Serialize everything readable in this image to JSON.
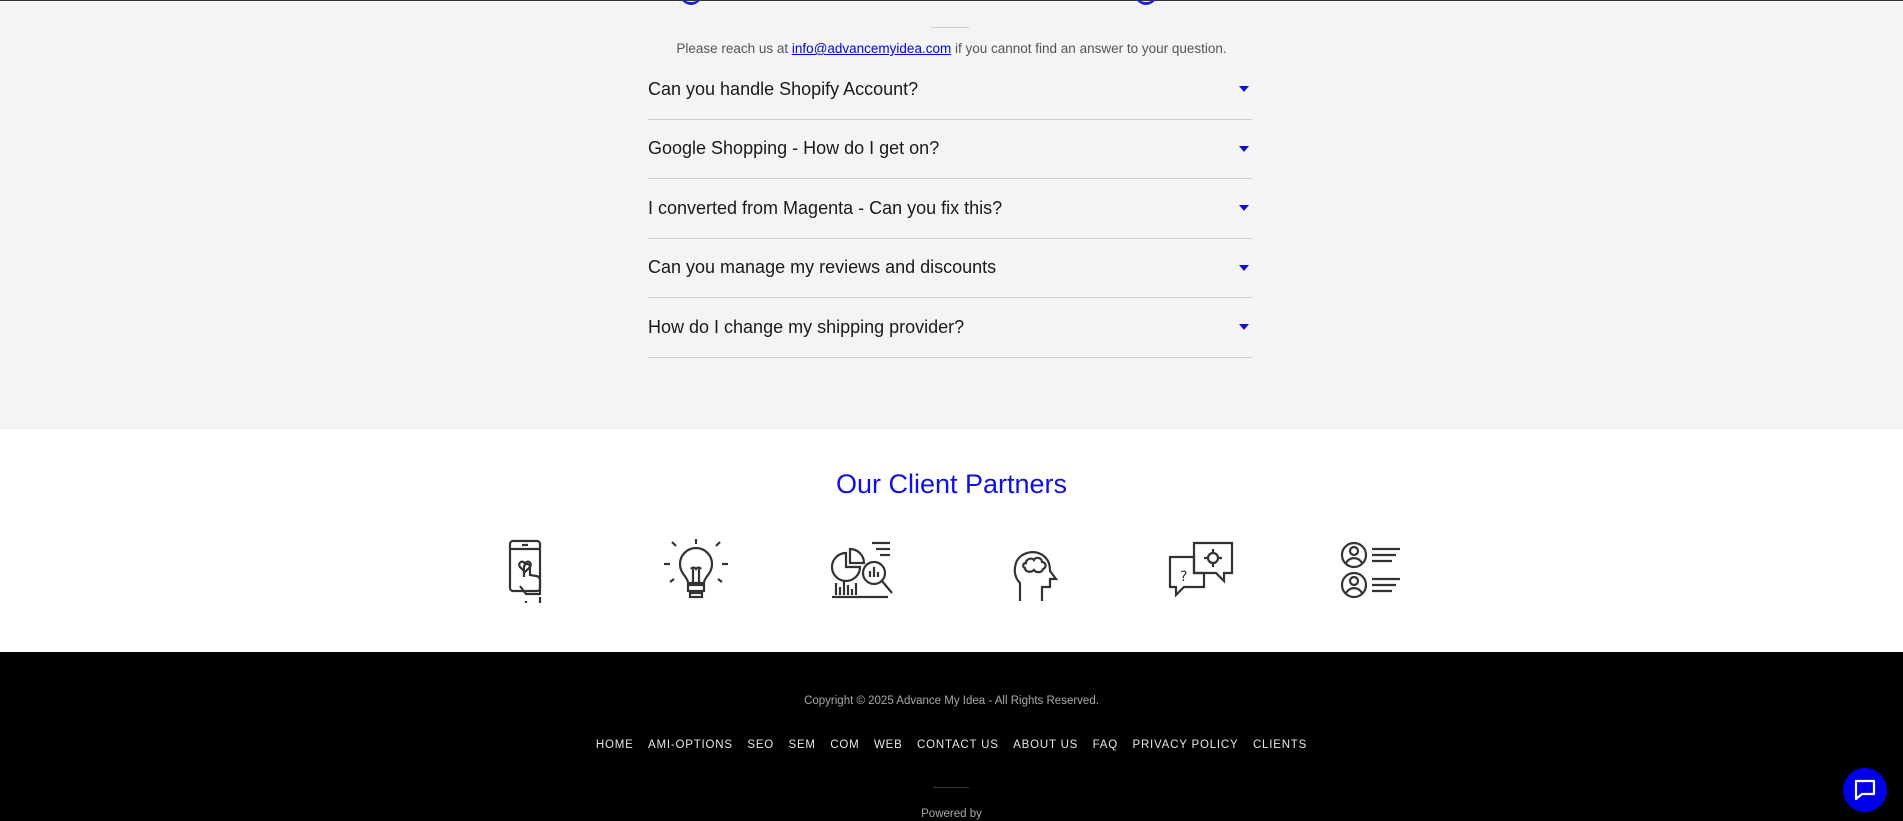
{
  "faq": {
    "contact_prefix": "Please reach us at",
    "contact_email": "info@advancemyidea.com",
    "contact_suffix": "if you cannot find an answer to your question.",
    "items": [
      {
        "question": "Can you handle Shopify Account?"
      },
      {
        "question": "Google Shopping - How do I get on?"
      },
      {
        "question": "I converted from Magenta - Can you fix this?"
      },
      {
        "question": "Can you manage my reviews and discounts"
      },
      {
        "question": "How do I change my shipping provider?"
      }
    ],
    "accent_color": "#1010d0"
  },
  "partners": {
    "title": "Our Client Partners",
    "icons": [
      "mobile-touch-icon",
      "lightbulb-icon",
      "analytics-chart-icon",
      "head-brain-icon",
      "support-chat-icon",
      "user-list-icon"
    ]
  },
  "footer": {
    "copyright": "Copyright © 2025 Advance My Idea - All Rights Reserved.",
    "nav": [
      "HOME",
      "AMI-OPTIONS",
      "SEO",
      "SEM",
      "COM",
      "WEB",
      "CONTACT US",
      "ABOUT US",
      "FAQ",
      "PRIVACY POLICY",
      "CLIENTS"
    ],
    "powered_by": "Powered by"
  },
  "chat": {
    "icon": "chat-bubble-icon",
    "color": "#0000e8"
  }
}
